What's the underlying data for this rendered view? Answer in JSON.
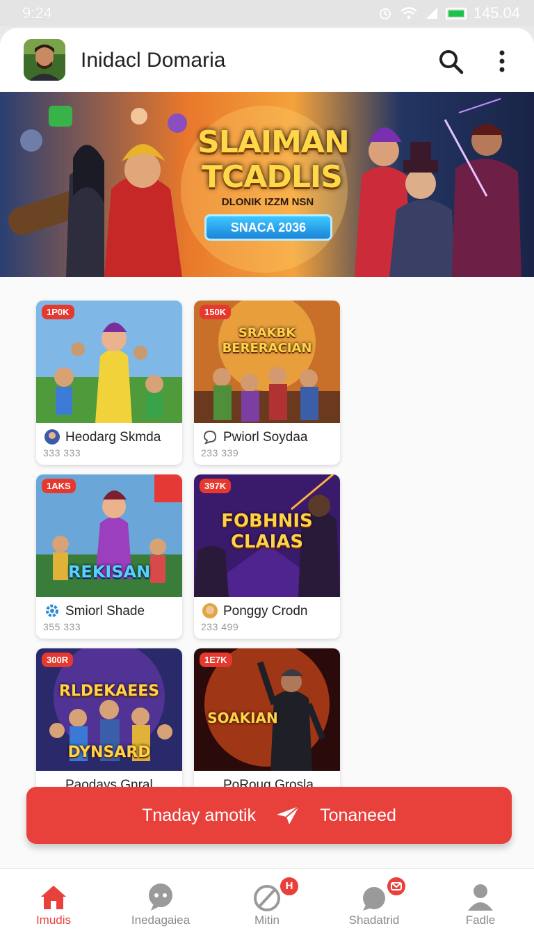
{
  "status_bar": {
    "time": "9:24",
    "battery_text": "145.04"
  },
  "app_bar": {
    "title": "Inidacl Domaria",
    "avatar_icon": "profile-avatar",
    "search_icon": "search-icon",
    "more_icon": "more-vertical-icon"
  },
  "banner": {
    "title_line1": "SLAIMAN",
    "title_line2": "TCADLIS",
    "subtitle": "DLONIK IZZM NSN",
    "button_label": "SNACA 2036"
  },
  "cards": [
    {
      "badge": "1P0K",
      "title": "Heodarg Skmda",
      "stats": "333  333",
      "art_text": ""
    },
    {
      "badge": "150K",
      "title": "Pwiorl Soydaa",
      "stats": "233  339",
      "art_text": "SRAKBK BERERACIAN"
    },
    {
      "badge": "1AKS",
      "title": "Smiorl Shade",
      "stats": "355  333",
      "art_text": "REKISAN"
    },
    {
      "badge": "397K",
      "title": "Ponggy Crodn",
      "stats": "233  499",
      "art_text": "FOBHNIS CLAIAS"
    },
    {
      "badge": "300R",
      "title": "Paodays Gnral",
      "stats": "",
      "art_text": "RLDEKAEES DYNSARD"
    },
    {
      "badge": "1E7K",
      "title": "PoRoug Grosla",
      "stats": "",
      "art_text": "SOAKIAN"
    }
  ],
  "cta": {
    "left_label": "Tnaday amotik",
    "right_label": "Tonaneed"
  },
  "bottom_nav": {
    "items": [
      {
        "label": "Imudis",
        "icon": "home-icon",
        "badge": ""
      },
      {
        "label": "Inedagaiea",
        "icon": "chat-icon",
        "badge": ""
      },
      {
        "label": "Mitin",
        "icon": "block-icon",
        "badge": "H"
      },
      {
        "label": "Shadatrid",
        "icon": "message-icon",
        "badge": ""
      },
      {
        "label": "Fadle",
        "icon": "profile-icon",
        "badge": ""
      }
    ]
  },
  "colors": {
    "accent": "#e8413c",
    "badge": "#e5392f"
  }
}
